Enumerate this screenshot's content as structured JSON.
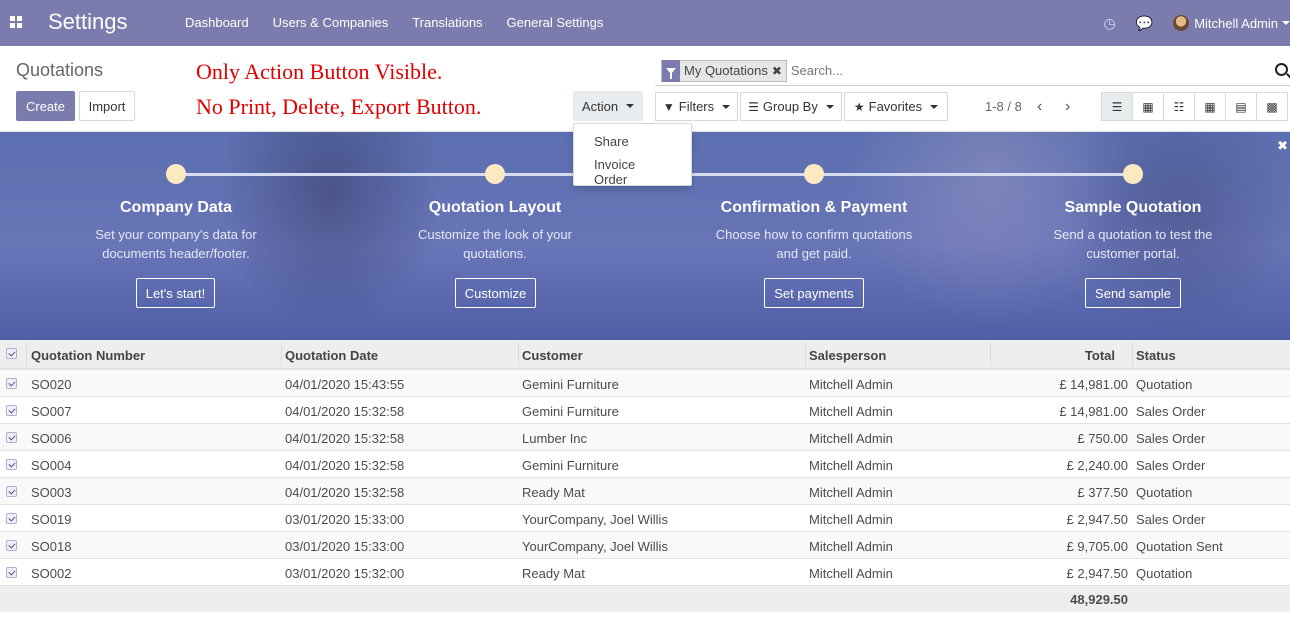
{
  "navbar": {
    "brand": "Settings",
    "menu": [
      "Dashboard",
      "Users & Companies",
      "Translations",
      "General Settings"
    ],
    "user": "Mitchell Admin"
  },
  "control": {
    "title": "Quotations",
    "create": "Create",
    "import": "Import",
    "action": "Action",
    "annotation_line1": "Only Action Button Visible.",
    "annotation_line2": "No Print, Delete, Export Button.",
    "facet": "My Quotations",
    "search_placeholder": "Search...",
    "filters": "Filters",
    "group_by": "Group By",
    "favorites": "Favorites",
    "pager": "1-8 / 8"
  },
  "action_menu": [
    "Share",
    "Invoice Order"
  ],
  "banner": {
    "steps": [
      {
        "title": "Company Data",
        "desc1": "Set your company's data for",
        "desc2": "documents header/footer.",
        "button": "Let's start!"
      },
      {
        "title": "Quotation Layout",
        "desc1": "Customize the look of your",
        "desc2": "quotations.",
        "button": "Customize"
      },
      {
        "title": "Confirmation & Payment",
        "desc1": "Choose how to confirm quotations",
        "desc2": "and get paid.",
        "button": "Set payments"
      },
      {
        "title": "Sample Quotation",
        "desc1": "Send a quotation to test the",
        "desc2": "customer portal.",
        "button": "Send sample"
      }
    ]
  },
  "table": {
    "columns": [
      "Quotation Number",
      "Quotation Date",
      "Customer",
      "Salesperson",
      "Total",
      "Status"
    ],
    "rows": [
      [
        "SO020",
        "04/01/2020 15:43:55",
        "Gemini Furniture",
        "Mitchell Admin",
        "£ 14,981.00",
        "Quotation"
      ],
      [
        "SO007",
        "04/01/2020 15:32:58",
        "Gemini Furniture",
        "Mitchell Admin",
        "£ 14,981.00",
        "Sales Order"
      ],
      [
        "SO006",
        "04/01/2020 15:32:58",
        "Lumber Inc",
        "Mitchell Admin",
        "£ 750.00",
        "Sales Order"
      ],
      [
        "SO004",
        "04/01/2020 15:32:58",
        "Gemini Furniture",
        "Mitchell Admin",
        "£ 2,240.00",
        "Sales Order"
      ],
      [
        "SO003",
        "04/01/2020 15:32:58",
        "Ready Mat",
        "Mitchell Admin",
        "£ 377.50",
        "Quotation"
      ],
      [
        "SO019",
        "03/01/2020 15:33:00",
        "YourCompany, Joel Willis",
        "Mitchell Admin",
        "£ 2,947.50",
        "Sales Order"
      ],
      [
        "SO018",
        "03/01/2020 15:33:00",
        "YourCompany, Joel Willis",
        "Mitchell Admin",
        "£ 9,705.00",
        "Quotation Sent"
      ],
      [
        "SO002",
        "03/01/2020 15:32:00",
        "Ready Mat",
        "Mitchell Admin",
        "£ 2,947.50",
        "Quotation"
      ]
    ],
    "total": "48,929.50"
  }
}
